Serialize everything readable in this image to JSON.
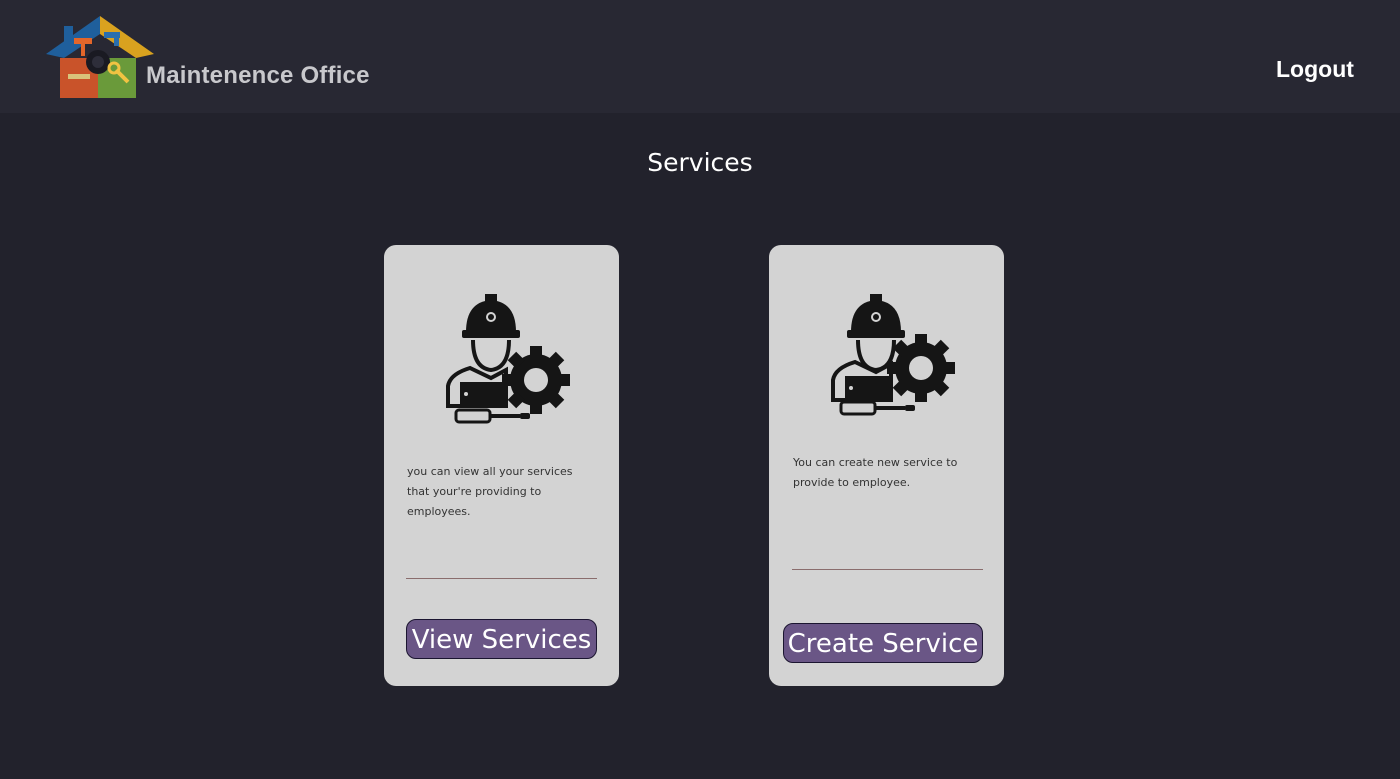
{
  "header": {
    "brand": "Maintenence Office",
    "logout_label": "Logout",
    "logo_icon": "house-tools-logo-icon"
  },
  "main": {
    "title": "Services",
    "cards": [
      {
        "icon": "worker-gear-icon",
        "description": "you can view all your services that your're providing to employees.",
        "button_label": "View Services"
      },
      {
        "icon": "worker-gear-icon",
        "description": "You can create new service to provide to employee.",
        "button_label": "Create Service"
      }
    ]
  },
  "colors": {
    "background": "#22222c",
    "header": "#282833",
    "card": "#d3d3d3",
    "button": "#6a5686"
  }
}
